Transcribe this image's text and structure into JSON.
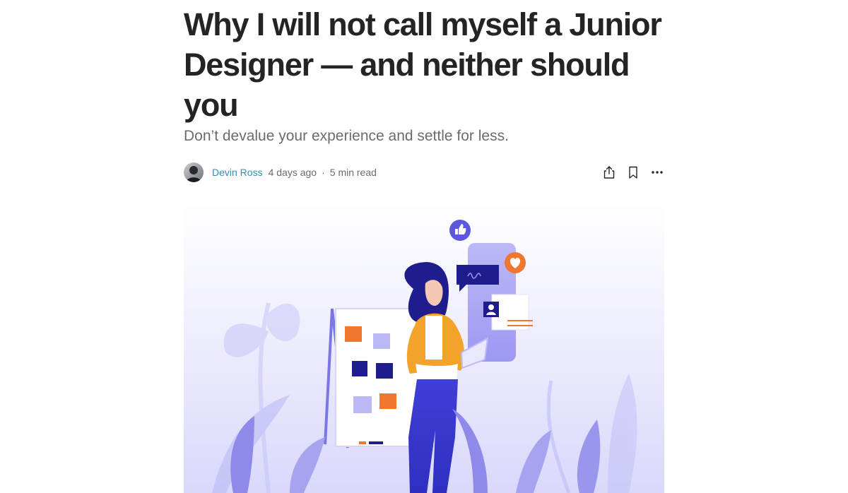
{
  "article": {
    "title": "Why I will not call myself a Junior Designer — and neither should you",
    "subtitle": "Don’t devalue your experience and settle for less.",
    "author": "Devin Ross",
    "published": "4 days ago",
    "separator": "·",
    "read_time": "5 min read"
  },
  "actions": {
    "share_icon": "share-icon",
    "bookmark_icon": "bookmark-icon",
    "more_icon": "more-icon"
  },
  "hero": {
    "illustration": "woman-with-tablet-illustration"
  },
  "colors": {
    "title": "#242424",
    "subtitle": "#6b6b6b",
    "author_link": "#2d8fb0",
    "accent_purple": "#7b74e8",
    "accent_orange": "#f0772e",
    "navy": "#1f1d8e"
  }
}
